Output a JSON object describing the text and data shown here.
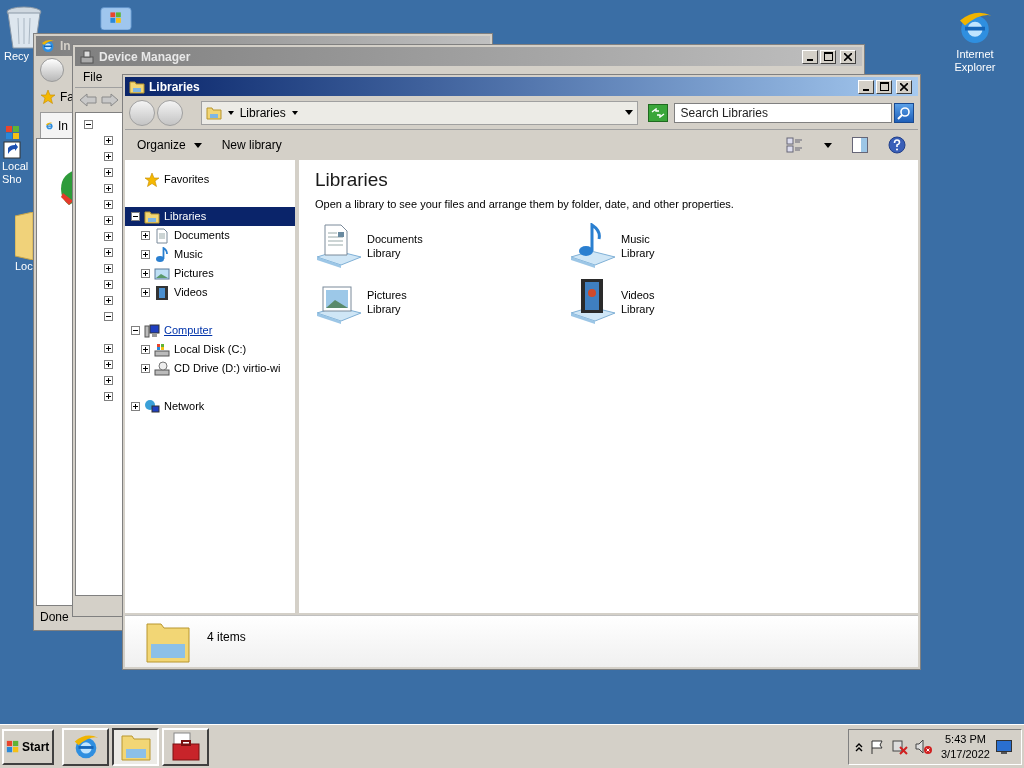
{
  "desktop": {
    "icons": [
      {
        "kind": "recycle",
        "lines": [
          "Recy"
        ]
      },
      {
        "kind": "windows"
      },
      {
        "kind": "shortcut",
        "lines": [
          "Local",
          "Sho"
        ]
      },
      {
        "kind": "folder",
        "lines": [
          "Loc"
        ]
      },
      {
        "kind": "ie",
        "lines": [
          "Internet",
          "Explorer"
        ]
      }
    ]
  },
  "ie_window": {
    "title": "In",
    "favorites": "Fa",
    "tab": "In",
    "status": "Done"
  },
  "device_manager": {
    "title": "Device Manager",
    "menu": [
      "File"
    ],
    "tree": [
      {
        "expanded": true
      },
      {
        "expanded": false
      },
      {
        "expanded": false
      },
      {
        "expanded": false
      },
      {
        "expanded": false
      },
      {
        "expanded": false
      },
      {
        "expanded": false
      },
      {
        "expanded": false
      },
      {
        "expanded": false
      },
      {
        "expanded": false
      },
      {
        "expanded": false
      },
      {
        "expanded": false
      },
      {
        "expanded": true
      },
      {
        "expanded": false
      },
      {
        "expanded": false
      },
      {
        "expanded": false
      },
      {
        "expanded": false
      }
    ]
  },
  "libraries_window": {
    "title": "Libraries",
    "address": "Libraries",
    "search": {
      "placeholder": "Search Libraries"
    },
    "commands": [
      "Organize",
      "New library"
    ],
    "nav": [
      {
        "label": "Favorites",
        "kind": "star",
        "selected": false,
        "hovered": false
      },
      {
        "label": "Libraries",
        "kind": "libraries",
        "selected": true,
        "hovered": false,
        "expanded": true,
        "children": [
          {
            "label": "Documents",
            "kind": "documents",
            "selected": false,
            "hovered": false,
            "expanded": false
          },
          {
            "label": "Music",
            "kind": "music",
            "selected": false,
            "hovered": false,
            "expanded": false
          },
          {
            "label": "Pictures",
            "kind": "pictures",
            "selected": false,
            "hovered": false,
            "expanded": false
          },
          {
            "label": "Videos",
            "kind": "videos",
            "selected": false,
            "hovered": false,
            "expanded": false
          }
        ]
      },
      {
        "label": "Computer",
        "kind": "computer",
        "selected": false,
        "hovered": true,
        "expanded": true,
        "children": [
          {
            "label": "Local Disk (C:)",
            "kind": "disk",
            "selected": false,
            "hovered": false,
            "expanded": false
          },
          {
            "label": "CD Drive (D:) virtio-wi",
            "kind": "cd",
            "selected": false,
            "hovered": false,
            "expanded": false
          }
        ]
      },
      {
        "label": "Network",
        "kind": "network",
        "selected": false,
        "hovered": false,
        "expanded": false
      }
    ],
    "heading": "Libraries",
    "description": "Open a library to see your files and arrange them by folder, date, and other properties.",
    "items": [
      {
        "name": "Documents",
        "type": "Library",
        "kind": "documents"
      },
      {
        "name": "Music",
        "type": "Library",
        "kind": "music"
      },
      {
        "name": "Pictures",
        "type": "Library",
        "kind": "pictures"
      },
      {
        "name": "Videos",
        "type": "Library",
        "kind": "videos"
      }
    ],
    "status": "4 items"
  },
  "taskbar": {
    "start": "Start",
    "buttons": [
      {
        "kind": "ie",
        "selected": false
      },
      {
        "kind": "explorer",
        "selected": true
      },
      {
        "kind": "toolbox",
        "selected": false
      }
    ],
    "time": "5:43 PM",
    "date": "3/17/2022"
  }
}
